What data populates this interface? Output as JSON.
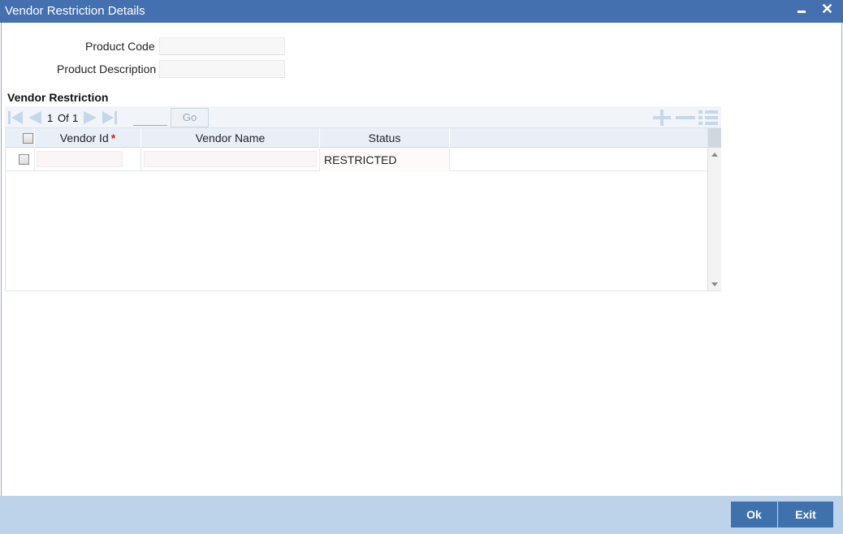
{
  "window": {
    "title": "Vendor Restriction Details",
    "minimize_icon": "minimize-icon",
    "close_icon": "close-icon"
  },
  "form": {
    "product_code_label": "Product Code",
    "product_code_value": "",
    "product_description_label": "Product Description",
    "product_description_value": ""
  },
  "vendor_restriction": {
    "title": "Vendor Restriction",
    "pager": {
      "current_page": "1",
      "of_label": "Of",
      "total_pages": "1",
      "page_input_value": "",
      "go_label": "Go"
    },
    "toolbar_icons": [
      "first-page-icon",
      "previous-page-icon",
      "next-page-icon",
      "last-page-icon",
      "add-row-icon",
      "delete-row-icon",
      "single-view-icon"
    ],
    "columns": [
      {
        "label": "Vendor Id",
        "required": "*"
      },
      {
        "label": "Vendor Name"
      },
      {
        "label": "Status"
      }
    ],
    "rows": [
      {
        "vendor_id": "",
        "vendor_name": "",
        "status": "RESTRICTED"
      }
    ]
  },
  "footer": {
    "ok_label": "Ok",
    "exit_label": "Exit"
  },
  "colors": {
    "titlebar": "#4470b0",
    "footer": "#bdd3ea",
    "button": "#3f72ad",
    "grid_header": "#e9eff6"
  }
}
